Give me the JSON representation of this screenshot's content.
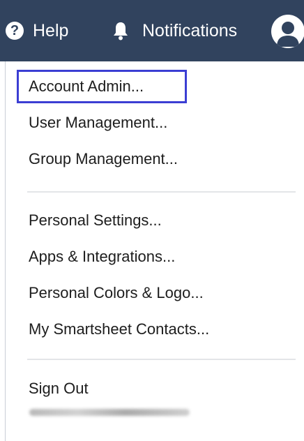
{
  "topbar": {
    "help_label": "Help",
    "help_icon_glyph": "?",
    "notifications_label": "Notifications",
    "background_color": "#31435e"
  },
  "menu": {
    "group1": [
      "Account Admin...",
      "User Management...",
      "Group Management..."
    ],
    "group2": [
      "Personal Settings...",
      "Apps & Integrations...",
      "Personal Colors & Logo...",
      "My Smartsheet Contacts..."
    ],
    "sign_out": "Sign Out",
    "highlight_color": "#3b3ed3"
  }
}
